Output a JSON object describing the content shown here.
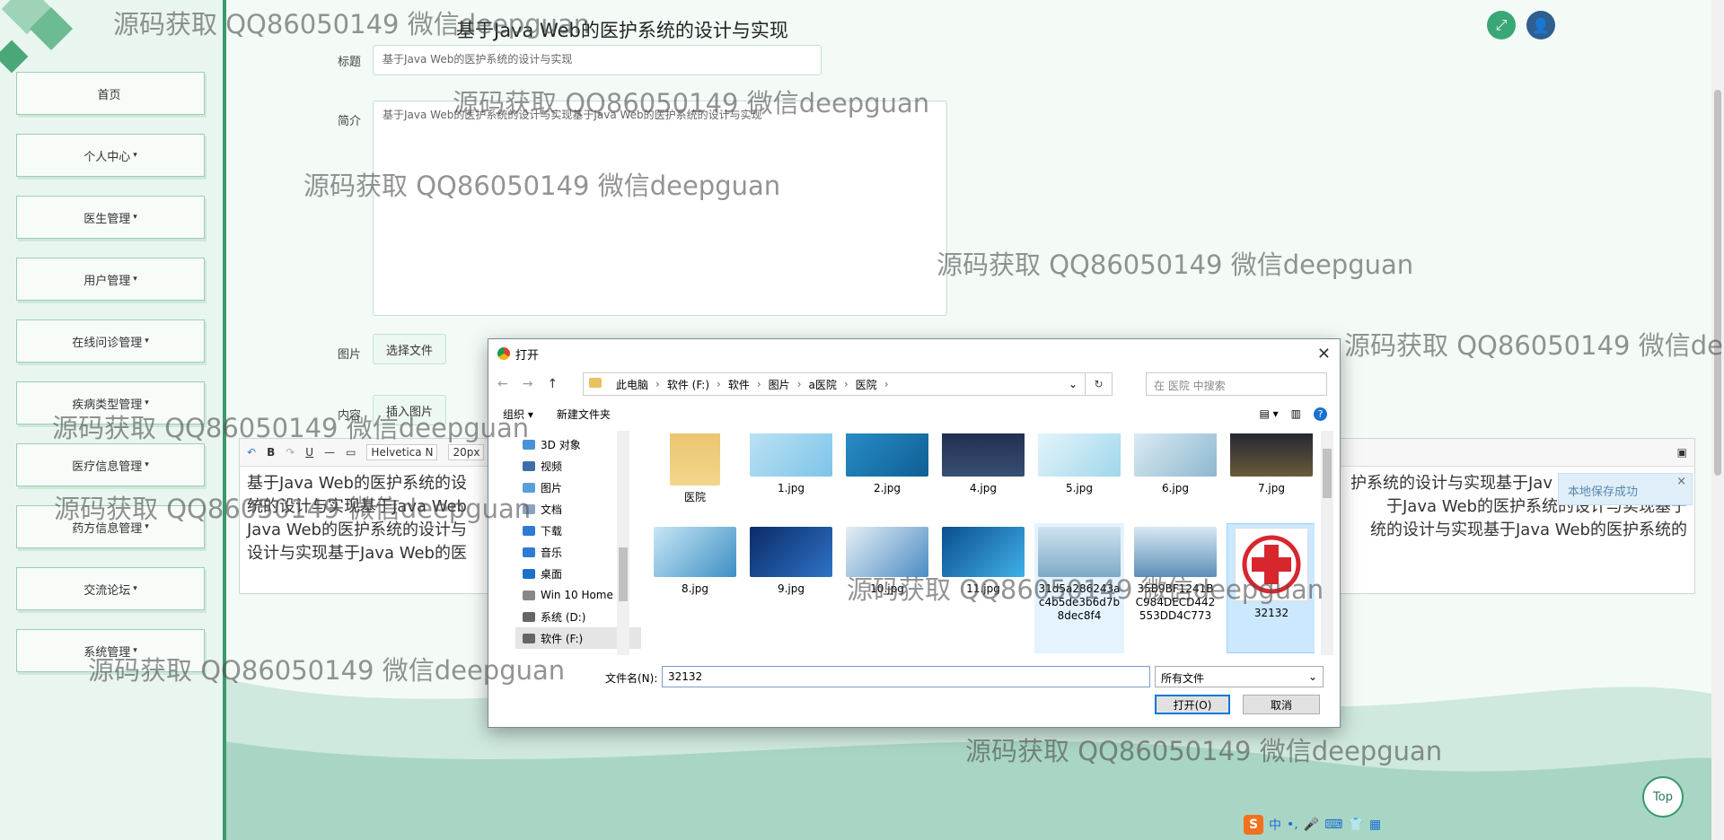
{
  "header": {
    "title": "基于Java Web的医护系统的设计与实现"
  },
  "sidebar": {
    "items": [
      {
        "label": "首页",
        "caret": ""
      },
      {
        "label": "个人中心",
        "caret": "▾"
      },
      {
        "label": "医生管理",
        "caret": "▾"
      },
      {
        "label": "用户管理",
        "caret": "▾"
      },
      {
        "label": "在线问诊管理",
        "caret": "▾"
      },
      {
        "label": "疾病类型管理",
        "caret": "▾"
      },
      {
        "label": "医疗信息管理",
        "caret": "▾"
      },
      {
        "label": "药方信息管理",
        "caret": "▾"
      },
      {
        "label": "交流论坛",
        "caret": "▾"
      },
      {
        "label": "系统管理",
        "caret": "▾"
      }
    ]
  },
  "form": {
    "title_label": "标题",
    "title_value": "基于Java Web的医护系统的设计与实现",
    "intro_label": "简介",
    "intro_value": "基于Java Web的医护系统的设计与实现基于Java Web的医护系统的设计与实现",
    "image_label": "图片",
    "choose_file": "选择文件",
    "content_label": "内容",
    "insert_image": "插入图片"
  },
  "editor": {
    "font": "Helvetica N",
    "size": "20px",
    "line1_left": "基于Java Web的医护系统的设",
    "line1_right": "护系统的设计与实现基于Jav",
    "line2_left": "统的设计与实现基于Java Web",
    "line2_right": "于Java Web的医护系统的设计与实现基于",
    "line3_left": "Java Web的医护系统的设计与",
    "line3_right": "统的设计与实现基于Java Web的医护系统的",
    "line4_left": "设计与实现基于Java Web的医"
  },
  "toast": {
    "text": "本地保存成功",
    "close": "×"
  },
  "watermark": "源码获取 QQ86050149 微信deepguan",
  "dialog": {
    "title": "打开",
    "breadcrumb": [
      "此电脑",
      "软件 (F:)",
      "软件",
      "图片",
      "a医院",
      "医院"
    ],
    "search_placeholder": "在 医院 中搜索",
    "organize": "组织 ▾",
    "new_folder": "新建文件夹",
    "tree": [
      {
        "label": "3D 对象",
        "color": "#4a90d9"
      },
      {
        "label": "视频",
        "color": "#3b6fa8"
      },
      {
        "label": "图片",
        "color": "#5aa0d8"
      },
      {
        "label": "文档",
        "color": "#8aa4c0"
      },
      {
        "label": "下载",
        "color": "#2f7bd4"
      },
      {
        "label": "音乐",
        "color": "#2f7bd4"
      },
      {
        "label": "桌面",
        "color": "#1f6fc9"
      },
      {
        "label": "Win 10 Home ›",
        "color": "#888888"
      },
      {
        "label": "系统 (D:)",
        "color": "#666666"
      },
      {
        "label": "软件 (F:)",
        "color": "#666666"
      }
    ],
    "files": [
      {
        "name": "医院",
        "bg": "linear-gradient(#e9c46a,#f4d58d)"
      },
      {
        "name": "1.jpg",
        "bg": "linear-gradient(135deg,#bfe3f4,#7cc4e8)"
      },
      {
        "name": "2.jpg",
        "bg": "linear-gradient(135deg,#2a8fc9,#0e5f93)"
      },
      {
        "name": "4.jpg",
        "bg": "linear-gradient(#1d2b4a,#394e73)"
      },
      {
        "name": "5.jpg",
        "bg": "linear-gradient(135deg,#e8f6fb,#9fd7ec)"
      },
      {
        "name": "6.jpg",
        "bg": "linear-gradient(135deg,#dfeef5,#8db7cf)"
      },
      {
        "name": "7.jpg",
        "bg": "linear-gradient(#1a1f33,#6a5a3a)"
      },
      {
        "name": "8.jpg",
        "bg": "linear-gradient(135deg,#c7e6f5,#3d8fc4)"
      },
      {
        "name": "9.jpg",
        "bg": "linear-gradient(135deg,#0a2c66,#2f72c7)"
      },
      {
        "name": "10.jpg",
        "bg": "linear-gradient(135deg,#e6eef5,#4b8cc4)"
      },
      {
        "name": "11.jpg",
        "bg": "linear-gradient(135deg,#0b4e8f,#3fb0e8)"
      },
      {
        "name": "31d5a286243ac4b5de3b6d7b8dec8f4",
        "bg": "linear-gradient(#cfe3ef,#7ea9c6)"
      },
      {
        "name": "35B9BF1241BC984DECD442553DD4C773",
        "bg": "linear-gradient(#d8e8f3,#5c8fb8)"
      },
      {
        "name": "32132",
        "bg": "#ffffff"
      }
    ],
    "filename_label": "文件名(N):",
    "filename_value": "32132",
    "filetype": "所有文件",
    "open_button": "打开(O)",
    "cancel_button": "取消"
  },
  "top_button": "Top",
  "ime": {
    "label": "中"
  }
}
